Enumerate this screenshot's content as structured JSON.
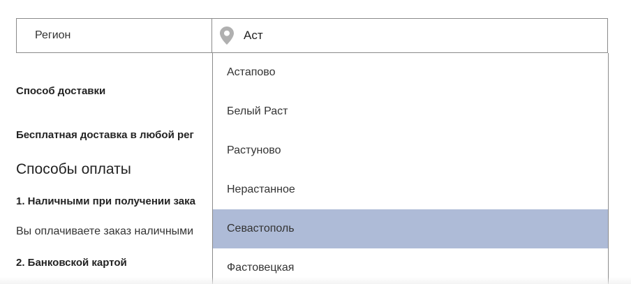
{
  "region": {
    "label": "Регион",
    "input_value": "Аст",
    "input_placeholder": ""
  },
  "content": {
    "delivery_heading": "Способ доставки",
    "free_delivery": "Бесплатная доставка в любой рег",
    "payment_heading": "Способы оплаты",
    "cash_title": "1. Наличными при получении зака",
    "cash_description": "Вы оплачиваете заказ наличными",
    "card_title": "2. Банковской картой"
  },
  "dropdown": {
    "items": [
      {
        "label": "Астапово"
      },
      {
        "label": "Белый Раст"
      },
      {
        "label": "Растуново"
      },
      {
        "label": "Нерастанное"
      },
      {
        "label": "Севастополь"
      },
      {
        "label": "Фастовецкая"
      }
    ],
    "selected_index": 4
  },
  "colors": {
    "selected_bg": "#aebbd7",
    "border": "#8a8a8a",
    "pin_icon": "#b0b0b0"
  },
  "icons": {
    "region_input_icon": "map-pin-icon"
  }
}
